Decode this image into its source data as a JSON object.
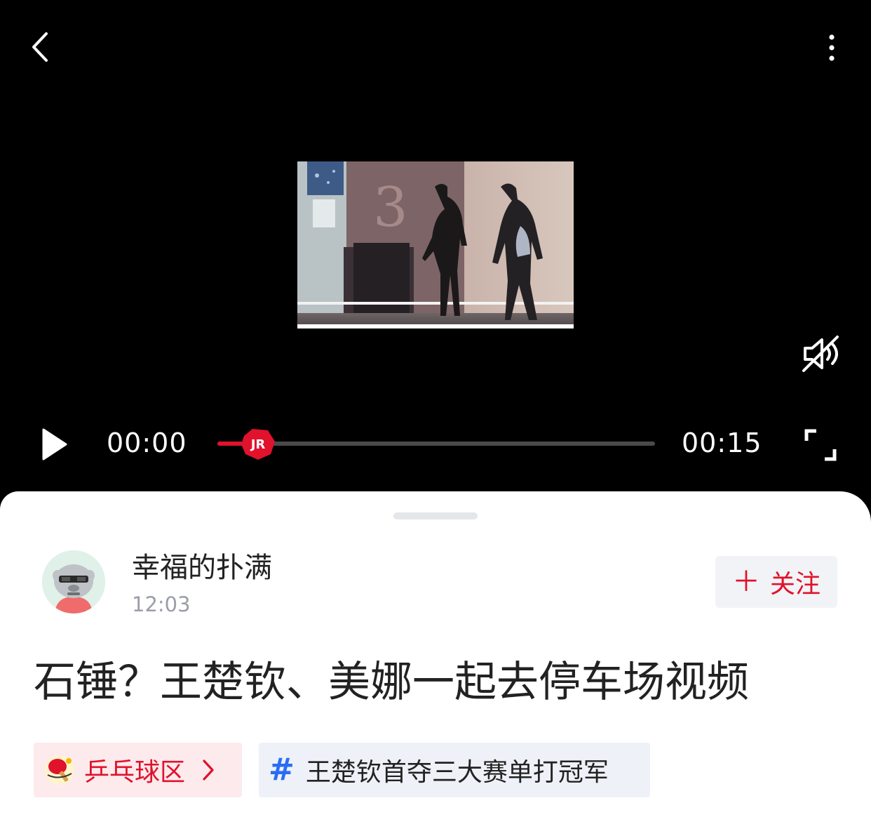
{
  "player": {
    "current_time": "00:00",
    "total_time": "00:15",
    "progress": 0,
    "muted": true,
    "thumb_logo": "JR",
    "frame_number": "3"
  },
  "author": {
    "name": "幸福的扑满",
    "time": "12:03",
    "follow_label": "关注"
  },
  "post": {
    "title": "石锤？王楚钦、美娜一起去停车场视频"
  },
  "tags": {
    "topic_label": "乒乓球区",
    "hashtag_label": "王楚钦首夺三大赛单打冠军"
  },
  "colors": {
    "accent": "#e0122c",
    "hashtag": "#2a6df4"
  }
}
